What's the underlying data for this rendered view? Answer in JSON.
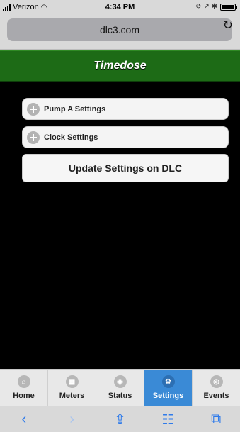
{
  "status_bar": {
    "carrier": "Verizon",
    "time": "4:34 PM",
    "right_icons": "⌞ ↗ ✱"
  },
  "browser": {
    "url": "dlc3.com",
    "reload_glyph": "↻"
  },
  "header": {
    "title": "Timedose",
    "color": "#1d6b16"
  },
  "sections": [
    {
      "label": "Pump A Settings"
    },
    {
      "label": "Clock Settings"
    }
  ],
  "update_button": {
    "label": "Update Settings on DLC"
  },
  "tabs": [
    {
      "label": "Home",
      "icon": "home-icon",
      "glyph": "⌂",
      "active": false
    },
    {
      "label": "Meters",
      "icon": "grid-icon",
      "glyph": "▦",
      "active": false
    },
    {
      "label": "Status",
      "icon": "eye-icon",
      "glyph": "◉",
      "active": false
    },
    {
      "label": "Settings",
      "icon": "gear-icon",
      "glyph": "⚙",
      "active": true
    },
    {
      "label": "Events",
      "icon": "search-icon",
      "glyph": "◎",
      "active": false
    }
  ],
  "toolbar": {
    "back": "‹",
    "forward": "›",
    "share": "⇪",
    "bookmarks": "☷",
    "tabs": "⧉"
  },
  "accent_color": "#3a8ad6"
}
